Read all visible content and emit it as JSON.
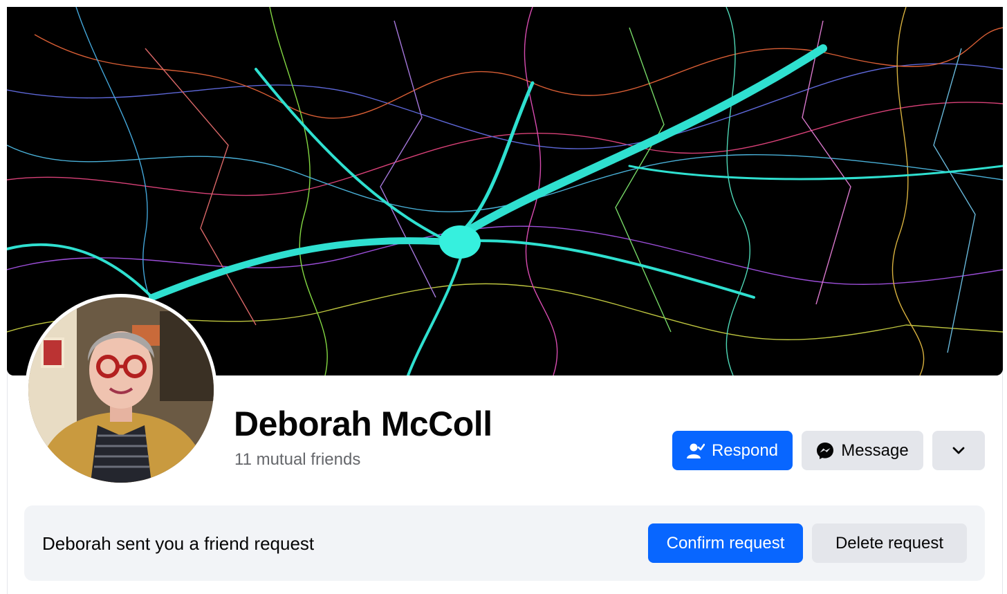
{
  "profile": {
    "name": "Deborah McColl",
    "mutual_friends": "11 mutual friends"
  },
  "actions": {
    "respond_label": "Respond",
    "message_label": "Message",
    "more_icon": "chevron-down-icon"
  },
  "friend_request": {
    "text": "Deborah sent you a friend request",
    "confirm_label": "Confirm request",
    "delete_label": "Delete request"
  },
  "colors": {
    "primary": "#0866ff",
    "secondary": "#e4e6eb",
    "muted_text": "#65676b",
    "request_bar": "#f2f4f7"
  }
}
